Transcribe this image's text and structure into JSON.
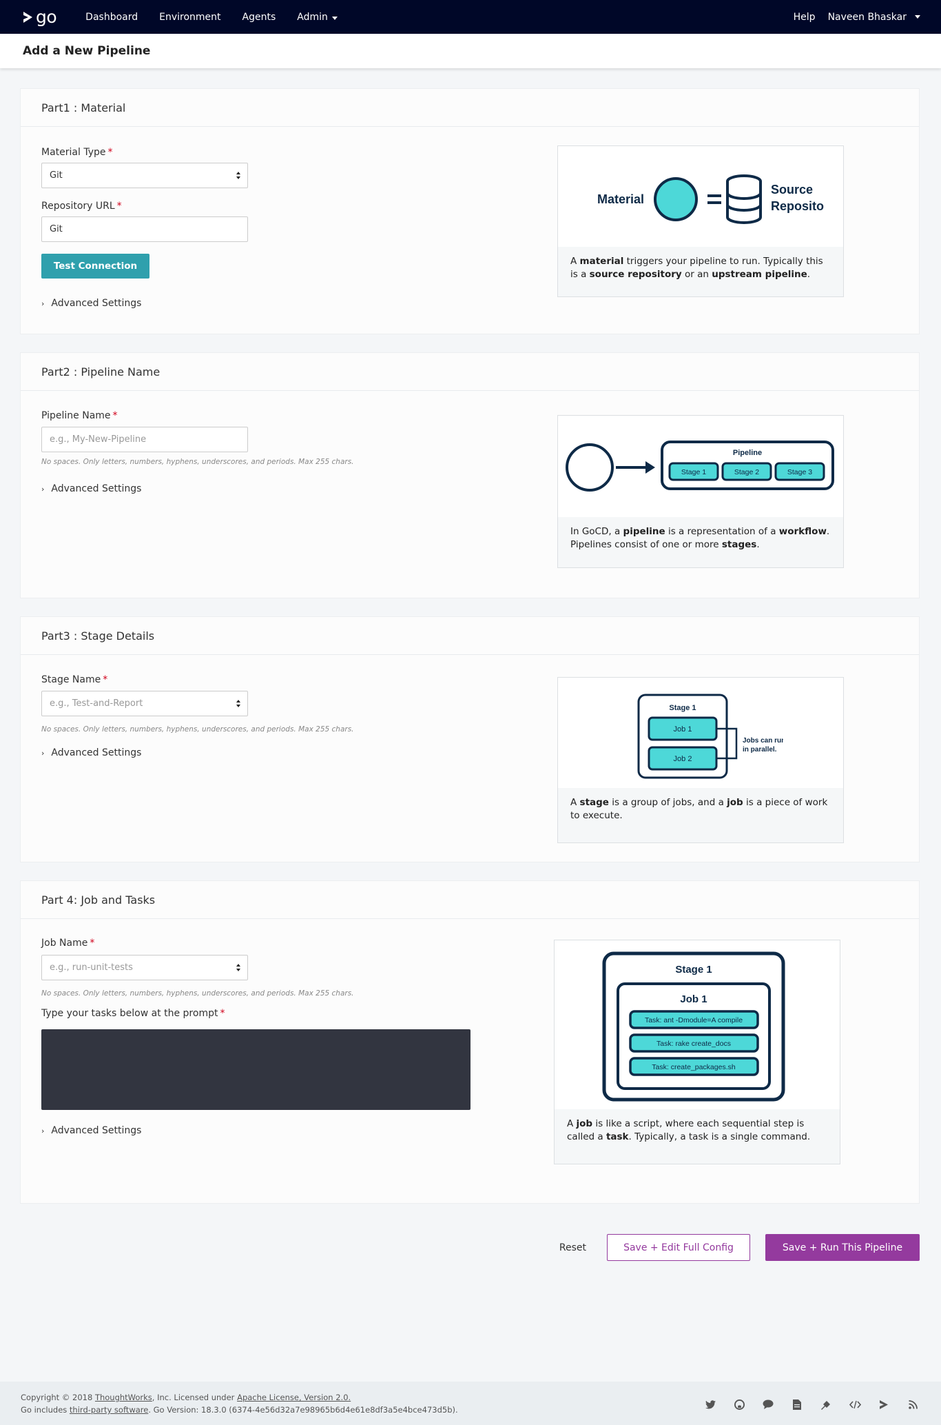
{
  "nav": {
    "logo_text": "go",
    "items": [
      "Dashboard",
      "Environment",
      "Agents",
      "Admin"
    ],
    "help": "Help",
    "user": "Naveen Bhaskar"
  },
  "page": {
    "title": "Add a New Pipeline"
  },
  "part1": {
    "title": "Part1 : Material",
    "material_type_label": "Material Type",
    "material_type_value": "Git",
    "repo_url_label": "Repository URL",
    "repo_url_value": "Git",
    "test_connection": "Test Connection",
    "advanced": "Advanced Settings",
    "illustration": {
      "left": "Material",
      "right_line1": "Source",
      "right_line2": "Repository"
    },
    "help": {
      "t1": "A ",
      "b1": "material",
      "t2": " triggers your pipeline to run. Typically this is a ",
      "b2": "source repository",
      "t3": " or an ",
      "b3": "upstream pipeline",
      "t4": "."
    }
  },
  "part2": {
    "title": "Part2 : Pipeline Name",
    "name_label": "Pipeline Name",
    "name_placeholder": "e.g., My-New-Pipeline",
    "hint": "No spaces. Only letters, numbers, hyphens, underscores, and periods. Max 255 chars.",
    "advanced": "Advanced Settings",
    "illustration": {
      "pipeline": "Pipeline",
      "stages": [
        "Stage 1",
        "Stage 2",
        "Stage 3"
      ]
    },
    "help": {
      "t1": "In GoCD, a ",
      "b1": "pipeline",
      "t2": " is a representation of a ",
      "b2": "workflow",
      "t3": ". Pipelines consist of one or more ",
      "b3": "stages",
      "t4": "."
    }
  },
  "part3": {
    "title": "Part3 : Stage Details",
    "name_label": "Stage Name",
    "name_placeholder": "e.g., Test-and-Report",
    "hint": "No spaces. Only letters, numbers, hyphens, underscores, and periods. Max 255 chars.",
    "advanced": "Advanced Settings",
    "illustration": {
      "stage": "Stage 1",
      "jobs": [
        "Job 1",
        "Job 2"
      ],
      "note_line1": "Jobs can run",
      "note_line2": "in parallel."
    },
    "help": {
      "t1": "A ",
      "b1": "stage",
      "t2": " is a group of jobs, and a ",
      "b2": "job",
      "t3": " is a piece of work to execute."
    }
  },
  "part4": {
    "title": "Part 4: Job and Tasks",
    "name_label": "Job Name",
    "name_placeholder": "e.g., run-unit-tests",
    "hint": "No spaces. Only letters, numbers, hyphens, underscores, and periods. Max 255 chars.",
    "tasks_label": "Type your tasks below at the prompt",
    "advanced": "Advanced Settings",
    "illustration": {
      "stage": "Stage 1",
      "job": "Job 1",
      "tasks": [
        "Task: ant -Dmodule=A compile",
        "Task: rake create_docs",
        "Task: create_packages.sh"
      ]
    },
    "help": {
      "t1": "A ",
      "b1": "job",
      "t2": " is like a script, where each sequential step is called a ",
      "b2": "task",
      "t3": ". Typically, a task is a single command."
    }
  },
  "actions": {
    "reset": "Reset",
    "save_edit": "Save + Edit Full Config",
    "save_run": "Save + Run This Pipeline"
  },
  "footer": {
    "line1_a": "Copyright © 2018 ",
    "line1_link1": "ThoughtWorks",
    "line1_b": ", Inc. Licensed under ",
    "line1_link2": "Apache License, Version 2.0.",
    "line2_a": "Go includes ",
    "line2_link": "third-party software",
    "line2_b": ". Go Version: 18.3.0 (6374-4e56d32a7e98965b6d4e61e8df3a5e4bce473d5b).",
    "icons": [
      "twitter-icon",
      "github-icon",
      "chat-icon",
      "document-icon",
      "plugin-icon",
      "api-icon",
      "gocd-icon",
      "rss-icon"
    ]
  },
  "colors": {
    "header_bg": "#000728",
    "accent": "#2fa0ad",
    "primary": "#943a9e",
    "illustration_fill": "#4dd8d8",
    "illustration_stroke": "#0e2a47"
  }
}
